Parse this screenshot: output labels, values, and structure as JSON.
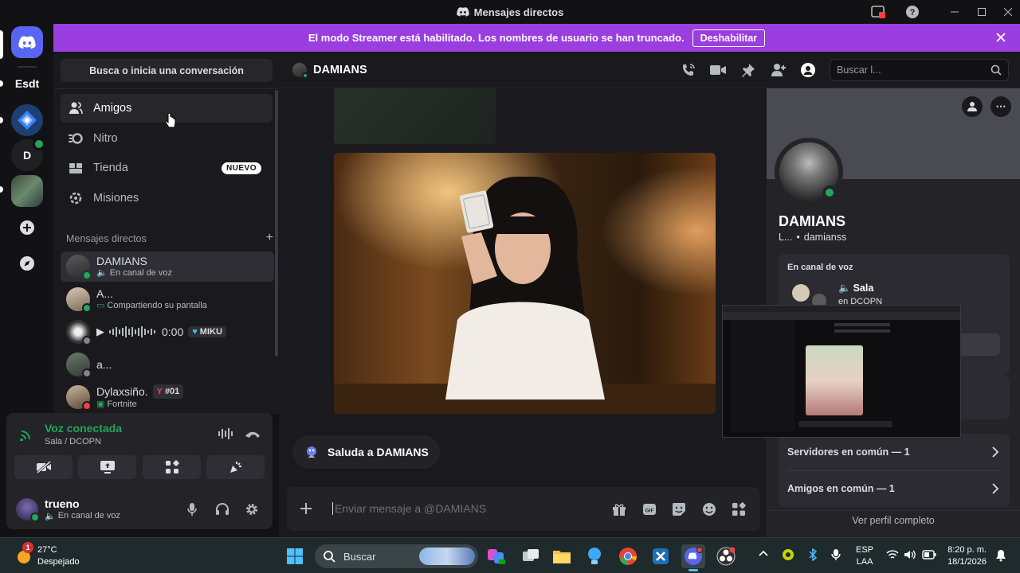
{
  "window": {
    "title": "Mensajes directos"
  },
  "streamer_banner": {
    "text": "El modo Streamer está habilitado. Los nombres de usuario se han truncado.",
    "button": "Deshabilitar"
  },
  "servers": [
    {
      "label": "Esdt"
    },
    {
      "label": "D"
    }
  ],
  "sidebar": {
    "search_label": "Busca o inicia una conversación",
    "nav": [
      {
        "label": "Amigos",
        "icon": "friends-icon"
      },
      {
        "label": "Nitro",
        "icon": "nitro-icon"
      },
      {
        "label": "Tienda",
        "icon": "shop-icon",
        "badge": "NUEVO"
      },
      {
        "label": "Misiones",
        "icon": "quests-icon"
      }
    ],
    "dm_header": "Mensajes directos",
    "dms": [
      {
        "name": "DAMIANS",
        "sub": "En canal de voz"
      },
      {
        "name": "A...",
        "sub": "Compartiendo su pantalla"
      },
      {
        "name": "",
        "time": "0:00",
        "tag": "MIKU"
      },
      {
        "name": "a...",
        "sub": ""
      },
      {
        "name": "Dylaxsiño.",
        "tag": "#01",
        "sub": "Fortnite"
      }
    ]
  },
  "voice_panel": {
    "title": "Voz conectada",
    "channel": "Sala / DCOPN"
  },
  "user_panel": {
    "name": "trueno",
    "status": "En canal de voz"
  },
  "chat": {
    "header_name": "DAMIANS",
    "search_placeholder": "Buscar l...",
    "wave_prompt": "Saluda a DAMIANS",
    "composer_placeholder": "Enviar mensaje a @DAMIANS"
  },
  "profile": {
    "name": "DAMIANS",
    "handle_prefix": "L...",
    "handle": "damianss",
    "voice_section": "En canal de voz",
    "voice_channel": "Sala",
    "voice_server": "en DCOPN",
    "mutual_servers": "Servidores en común — 1",
    "mutual_friends": "Amigos en común — 1",
    "view_full": "Ver perfil completo"
  },
  "taskbar": {
    "weather_temp": "27°C",
    "weather_desc": "Despejado",
    "weather_badge": "1",
    "search": "Buscar",
    "lang_top": "ESP",
    "lang_bottom": "LAA",
    "time": "8:20 p. m.",
    "date": "18/1/2026"
  },
  "colors": {
    "accent": "#5865f2",
    "streamer": "#9b3ee0",
    "online": "#23a55a",
    "dnd": "#f23f43"
  }
}
